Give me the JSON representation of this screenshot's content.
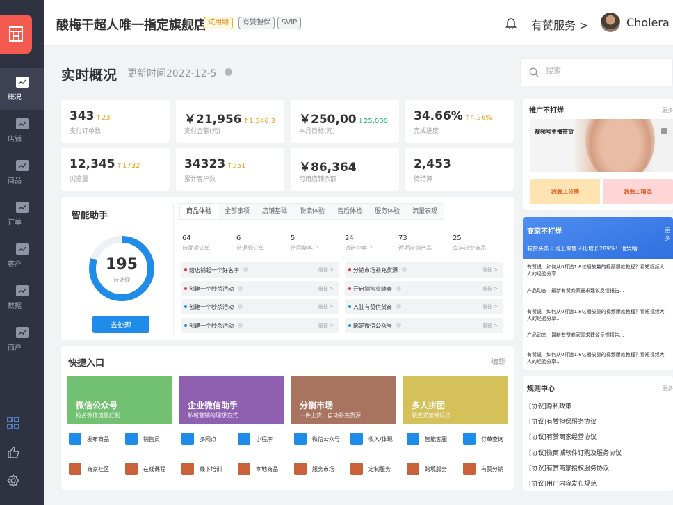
{
  "sidebar": {
    "items": [
      {
        "label": "概况",
        "active": true
      },
      {
        "label": "店铺"
      },
      {
        "label": "商品"
      },
      {
        "label": "订单"
      },
      {
        "label": "客户"
      },
      {
        "label": "数据"
      },
      {
        "label": "商户"
      }
    ],
    "bottom_icons": [
      "grid-icon",
      "thumbs-up-icon",
      "settings-icon"
    ]
  },
  "header": {
    "store_name": "酸梅干超人唯一指定旗舰店",
    "tags": [
      "试用期",
      "有赞担保",
      "SVIP"
    ],
    "service": "有赞服务 >",
    "user": "Cholera >"
  },
  "page": {
    "title": "实时概况",
    "update_time": "更新时间2022-12-5"
  },
  "search": {
    "placeholder": "搜索"
  },
  "stats": [
    {
      "value": "343",
      "delta": "↑23",
      "dir": "up",
      "label": "支付订单数"
    },
    {
      "value": "￥21,956",
      "delta": "↑1,546.3",
      "dir": "up",
      "label": "支付金额(元)"
    },
    {
      "value": "￥250,00",
      "delta": "↓25,000",
      "dir": "down",
      "label": "本月目标(元)"
    },
    {
      "value": "34.66%",
      "delta": "↑4.26%",
      "dir": "up",
      "label": "完成进度"
    },
    {
      "value": "12,345",
      "delta": "↑1732",
      "dir": "up",
      "label": "浏览量"
    },
    {
      "value": "34323",
      "delta": "↑251",
      "dir": "up",
      "label": "累计客户数"
    },
    {
      "value": "￥86,364",
      "delta": "",
      "dir": "up",
      "label": "可用店铺余额"
    },
    {
      "value": "2,453",
      "delta": "",
      "dir": "up",
      "label": "待结算"
    }
  ],
  "assistant": {
    "title": "智能助手",
    "tabs": [
      "商品体验",
      "全部事项",
      "店铺基础",
      "物流体验",
      "售后体检",
      "服务体验",
      "流量表现"
    ],
    "metrics": [
      {
        "value": "64",
        "label": "待发货订单"
      },
      {
        "value": "6",
        "label": "待退款订单"
      },
      {
        "value": "5",
        "label": "待回复客户"
      },
      {
        "value": "24",
        "label": "派送中客户"
      },
      {
        "value": "73",
        "label": "近期滞销产品"
      },
      {
        "value": "25",
        "label": "库存过少商品"
      }
    ],
    "pending_count": "195",
    "pending_label": "待处理",
    "pending_progress": 0.8,
    "button": "去处理",
    "tasks_left": [
      {
        "text": "给店铺起一个好名字",
        "go": "前往 >",
        "color": "#e0383e"
      },
      {
        "text": "创建一个秒杀活动",
        "go": "前往 >",
        "color": "#e0383e"
      },
      {
        "text": "创建一个秒杀活动",
        "go": "前往 >",
        "color": "#1f8cea"
      },
      {
        "text": "创建一个秒杀活动",
        "go": "前往 >",
        "color": "#1f8cea"
      }
    ],
    "tasks_right": [
      {
        "text": "分销市场补充货源",
        "go": "前往 >",
        "color": "#e0383e"
      },
      {
        "text": "开启销售业绩表",
        "go": "前往 >",
        "color": "#e0383e"
      },
      {
        "text": "入驻有赞供货商",
        "go": "前往 >",
        "color": "#1f8cea"
      },
      {
        "text": "绑定微信公众号",
        "go": "前往 >",
        "color": "#1f8cea"
      }
    ]
  },
  "quick": {
    "title": "快捷入口",
    "edit": "编辑",
    "cards": [
      {
        "title": "微信公众号",
        "sub": "抢占微信流量红利",
        "color": "#72c072"
      },
      {
        "title": "企业微信助手",
        "sub": "私域营销的理想方式",
        "color": "#8f5fb0"
      },
      {
        "title": "分销市场",
        "sub": "一件上货，自动补充货源",
        "color": "#a87460"
      },
      {
        "title": "多人拼团",
        "sub": "裂变式营销玩法",
        "color": "#d4c15a"
      }
    ],
    "row1": [
      "发布商品",
      "销售员",
      "多网点",
      "小程序",
      "微信公众号",
      "收入/体现",
      "智能客服",
      "订单查询"
    ],
    "row2": [
      "商家社区",
      "在线课程",
      "线下培训",
      "本地商品",
      "服务市场",
      "定制服务",
      "跨境服务",
      "有赞分销"
    ],
    "row1_color": "#1f8cea",
    "row2_color": "#c9623a"
  },
  "promo": {
    "title": "推广不打烊",
    "more": "更多",
    "banner_text": "视频号主播带货",
    "btn1": "我要上分销",
    "btn2": "我要上精选"
  },
  "merchant": {
    "title": "商家不打烊",
    "more": "更多",
    "headline": "有赞头条｜线上零售环比增长289%！他凭啥...",
    "news": [
      "有赞说｜如何从0打造1.8亿播放量的视频爆款教程？看短视频大人的经验分享...",
      "产品动态｜最新有赞商家需求建议反馈报告...",
      "有赞说｜如何从0打造1.8亿播放量的视频爆款教程？看短视频大人的经验分享...",
      "产品动态｜最新有赞商家需求建议反馈报告...",
      "有赞说｜如何从0打造1.8亿播放量的视频爆款教程？看短视频大人的经验分享..."
    ]
  },
  "rules": {
    "title": "规则中心",
    "more": "更多",
    "items": [
      "[协议]隐私政策",
      "[协议]有赞担保服务协议",
      "[协议]有赞商家经营协议",
      "[协议]微商城软件订购及服务协议",
      "[协议]有赞商家授权服务协议",
      "[协议]用户内容发布规范"
    ]
  }
}
